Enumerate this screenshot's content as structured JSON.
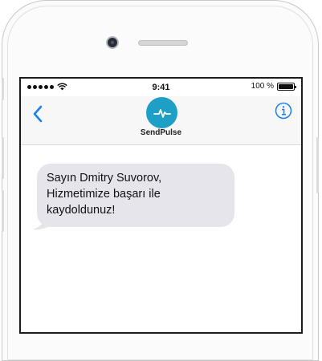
{
  "status_bar": {
    "time": "9:41",
    "battery_text": "100 %",
    "battery_level": 1.0
  },
  "header": {
    "contact_name": "SendPulse",
    "back_icon": "chevron-left-icon",
    "info_icon": "info-circle-icon",
    "avatar_icon": "pulse-wave-icon"
  },
  "messages": [
    {
      "direction": "incoming",
      "lines": [
        "Sayın Dmitry Suvorov,",
        "Hizmetimize başarı ile",
        "kaydoldunuz!"
      ]
    }
  ],
  "colors": {
    "accent": "#1a7ff0",
    "avatar_bg": "#1ea0c6",
    "bubble_incoming": "#e6e5eb"
  }
}
